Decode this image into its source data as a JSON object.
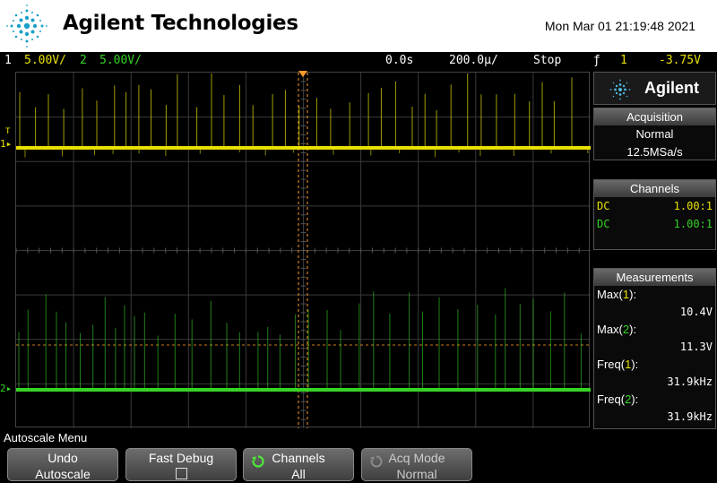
{
  "header": {
    "brand": "Agilent Technologies",
    "datetime": "Mon Mar 01 21:19:48 2021"
  },
  "statusbar": {
    "ch1_num": "1",
    "ch1_scale": "5.00V/",
    "ch2_num": "2",
    "ch2_scale": "5.00V/",
    "time_delay": "0.0s",
    "time_scale": "200.0µ/",
    "run_state": "Stop",
    "trigger_source": "1",
    "trigger_level": "-3.75V"
  },
  "markers": {
    "ch1": "1",
    "ch2": "2",
    "trigger": "T"
  },
  "panel": {
    "agilent_label": "Agilent",
    "acquisition": {
      "title": "Acquisition",
      "mode": "Normal",
      "rate": "12.5MSa/s"
    },
    "channels": {
      "title": "Channels",
      "rows": [
        {
          "coupling": "DC",
          "probe": "1.00:1",
          "color": "#e8e000"
        },
        {
          "coupling": "DC",
          "probe": "1.00:1",
          "color": "#35d425"
        }
      ]
    },
    "measurements": {
      "title": "Measurements",
      "items": [
        {
          "label": "Max(",
          "ch": "1",
          "close": "):",
          "value": "10.4V",
          "color": "#e8e000"
        },
        {
          "label": "Max(",
          "ch": "2",
          "close": "):",
          "value": "11.3V",
          "color": "#35d425"
        },
        {
          "label": "Freq(",
          "ch": "1",
          "close": "):",
          "value": "31.9kHz",
          "color": "#e8e000"
        },
        {
          "label": "Freq(",
          "ch": "2",
          "close": "):",
          "value": "31.9kHz",
          "color": "#35d425"
        }
      ]
    }
  },
  "softmenu": {
    "title": "Autoscale Menu",
    "keys": [
      {
        "line1": "Undo",
        "line2": "Autoscale"
      },
      {
        "line1": "Fast Debug",
        "line2": ""
      },
      {
        "line1": "Channels",
        "line2": "All"
      },
      {
        "line1": "Acq Mode",
        "line2": "Normal"
      }
    ]
  },
  "colors": {
    "ch1": "#e8e000",
    "ch2": "#35d425",
    "trigger": "#ff9a2a"
  }
}
